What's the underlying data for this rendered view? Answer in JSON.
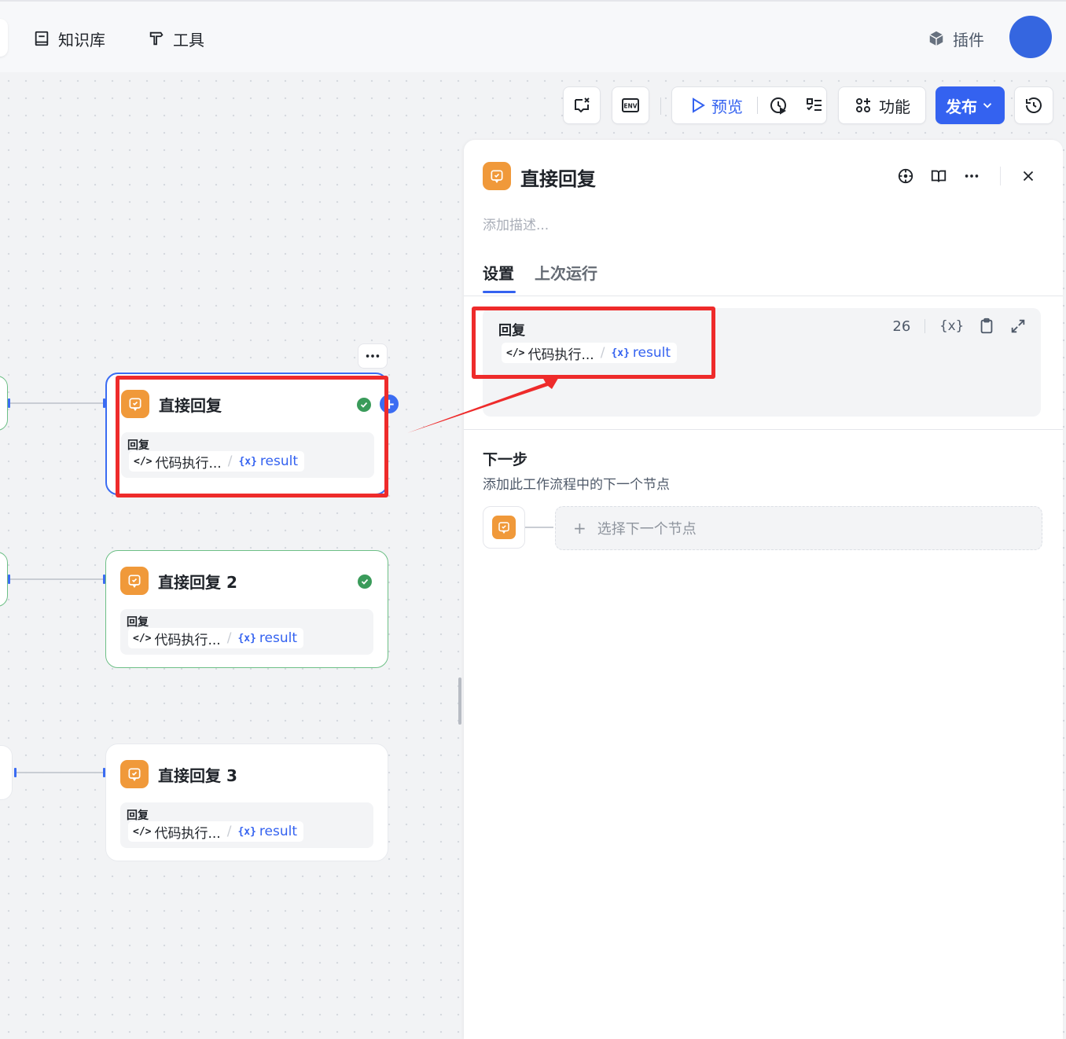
{
  "nav": {
    "knowledge_label": "知识库",
    "tools_label": "工具",
    "plugins_label": "插件"
  },
  "toolbar": {
    "preview_label": "预览",
    "function_label": "功能",
    "publish_label": "发布",
    "env_label": "ENV"
  },
  "nodes": [
    {
      "title": "直接回复",
      "label": "回复",
      "source": "代码执行...",
      "var": "result",
      "status": "success"
    },
    {
      "title": "直接回复 2",
      "label": "回复",
      "source": "代码执行...",
      "var": "result",
      "status": "success"
    },
    {
      "title": "直接回复 3",
      "label": "回复",
      "source": "代码执行...",
      "var": "result",
      "status": "none"
    }
  ],
  "panel": {
    "title": "直接回复",
    "description_placeholder": "添加描述...",
    "tabs": [
      {
        "label": "设置",
        "active": true
      },
      {
        "label": "上次运行",
        "active": false
      }
    ],
    "reply": {
      "label": "回复",
      "char_count": "26",
      "var_token": "{x}",
      "source": "代码执行...",
      "var": "result"
    },
    "next_step": {
      "title": "下一步",
      "subtitle": "添加此工作流程中的下一个节点",
      "select_label": "选择下一个节点"
    }
  },
  "colors": {
    "accent": "#3462f0",
    "node_icon": "#f0993a",
    "success": "#3a9b5a",
    "annotation": "#ee2b2b"
  },
  "icons": {
    "reply_node": "chat-check-icon",
    "code": "code-icon",
    "variable": "variable-icon"
  }
}
